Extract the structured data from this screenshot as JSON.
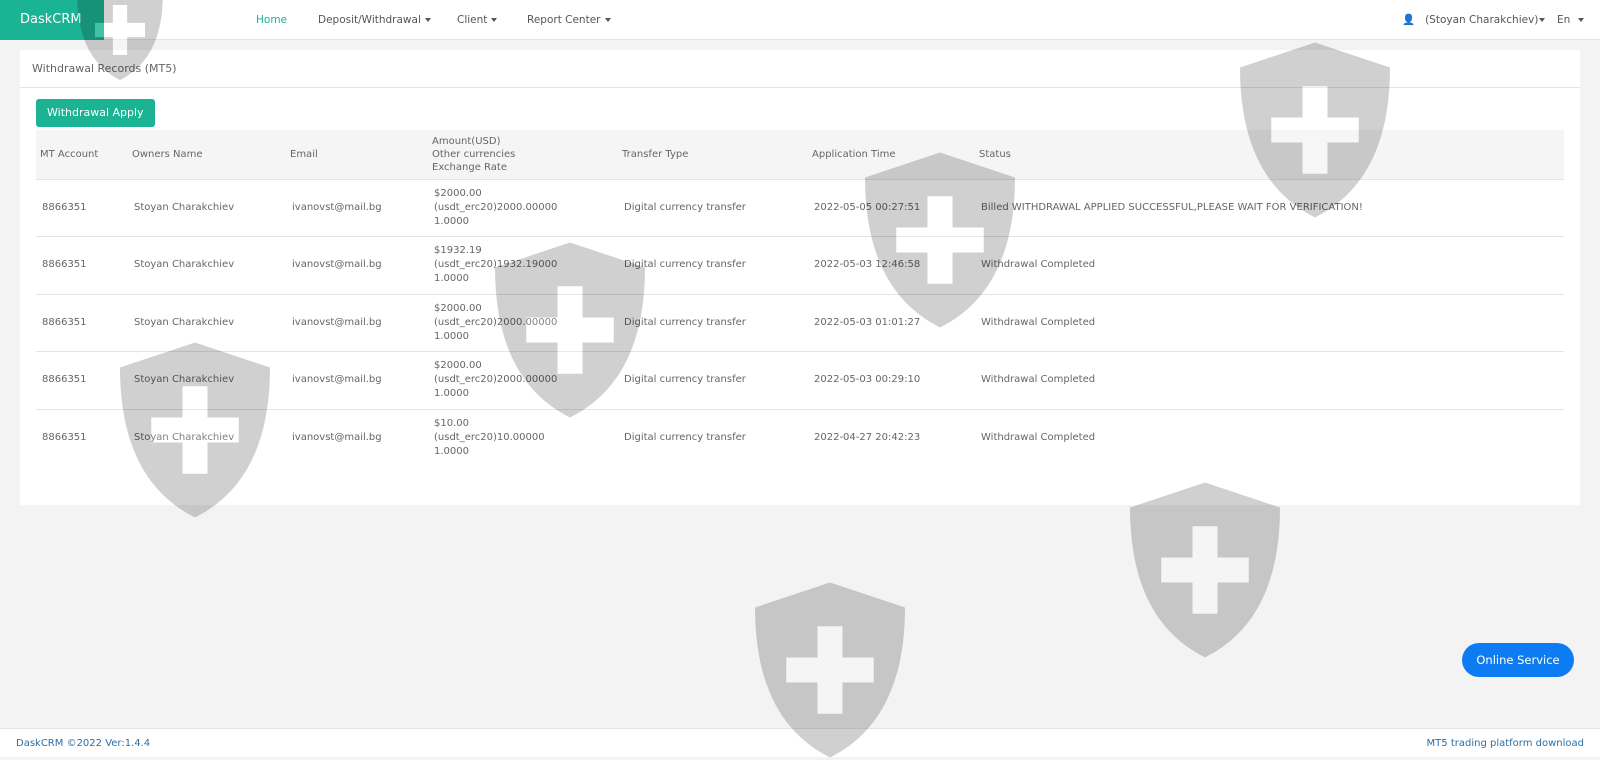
{
  "nav": {
    "brand": "DaskCRM",
    "items": [
      "Home",
      "Deposit/Withdrawal",
      "Client",
      "Report Center"
    ],
    "user": "(Stoyan Charakchiev)",
    "lang": "En"
  },
  "panel": {
    "title": "Withdrawal Records  (MT5)",
    "apply_button": "Withdrawal Apply"
  },
  "table": {
    "headers": [
      "MT Account",
      "Owners Name",
      "Email",
      [
        "Amount(USD)",
        "Other currencies",
        "Exchange Rate"
      ],
      "Transfer Type",
      "Application Time",
      "Status"
    ],
    "rows": [
      {
        "account": "8866351",
        "name": "Stoyan Charakchiev",
        "email": "ivanovst@mail.bg",
        "amount": "$2000.00",
        "other": "(usdt_erc20)2000.00000",
        "rate": "1.0000",
        "type": "Digital currency transfer",
        "time": "2022-05-05 00:27:51",
        "status": "Billed WITHDRAWAL APPLIED SUCCESSFUL,PLEASE WAIT FOR VERIFICATION!"
      },
      {
        "account": "8866351",
        "name": "Stoyan Charakchiev",
        "email": "ivanovst@mail.bg",
        "amount": "$1932.19",
        "other": "(usdt_erc20)1932.19000",
        "rate": "1.0000",
        "type": "Digital currency transfer",
        "time": "2022-05-03 12:46:58",
        "status": "Withdrawal Completed"
      },
      {
        "account": "8866351",
        "name": "Stoyan Charakchiev",
        "email": "ivanovst@mail.bg",
        "amount": "$2000.00",
        "other": "(usdt_erc20)2000.00000",
        "rate": "1.0000",
        "type": "Digital currency transfer",
        "time": "2022-05-03 01:01:27",
        "status": "Withdrawal Completed"
      },
      {
        "account": "8866351",
        "name": "Stoyan Charakchiev",
        "email": "ivanovst@mail.bg",
        "amount": "$2000.00",
        "other": "(usdt_erc20)2000.00000",
        "rate": "1.0000",
        "type": "Digital currency transfer",
        "time": "2022-05-03 00:29:10",
        "status": "Withdrawal Completed"
      },
      {
        "account": "8866351",
        "name": "Stoyan Charakchiev",
        "email": "ivanovst@mail.bg",
        "amount": "$10.00",
        "other": "(usdt_erc20)10.00000",
        "rate": "1.0000",
        "type": "Digital currency transfer",
        "time": "2022-04-27 20:42:23",
        "status": "Withdrawal Completed"
      }
    ]
  },
  "online_service": "Online Service",
  "footer": {
    "left": "DaskCRM ©2022 Ver:1.4.4",
    "right": "MT5 trading platform download"
  },
  "colors": {
    "accent": "#1ab394",
    "online": "#0d7cf2",
    "link": "#2a6ea8"
  }
}
